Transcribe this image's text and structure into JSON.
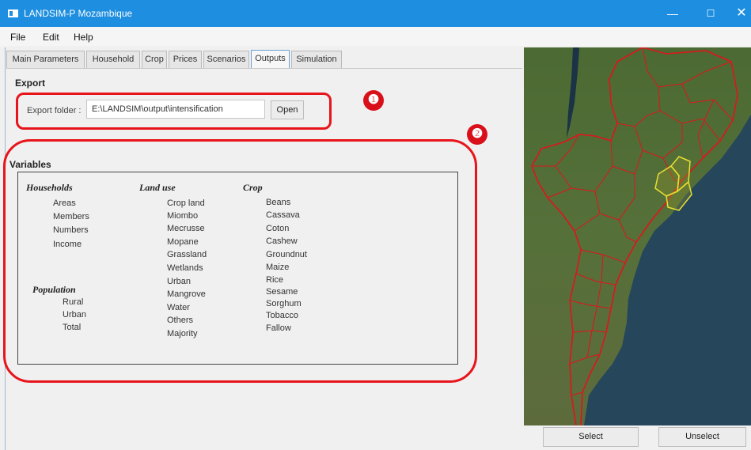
{
  "window": {
    "title": "LANDSIM-P Mozambique"
  },
  "menu": [
    "File",
    "Edit",
    "Help"
  ],
  "tabs": [
    "Main Parameters",
    "Household",
    "Crop",
    "Prices",
    "Scenarios",
    "Outputs",
    "Simulation"
  ],
  "active_tab": "Outputs",
  "export": {
    "heading": "Export",
    "folder_label": "Export folder :",
    "folder_value": "E:\\LANDSIM\\output\\intensification",
    "open_label": "Open"
  },
  "variables": {
    "heading": "Variables",
    "households": {
      "title": "Households",
      "items": [
        "Areas",
        "Members",
        "Numbers",
        "Income"
      ]
    },
    "population": {
      "title": "Population",
      "items": [
        "Rural",
        "Urban",
        "Total"
      ]
    },
    "land_use": {
      "title": "Land use",
      "items": [
        "Crop land",
        "Miombo",
        "Mecrusse",
        "Mopane",
        "Grassland",
        "Wetlands",
        "Urban",
        "Mangrove",
        "Water",
        "Others",
        "Majority"
      ]
    },
    "crop": {
      "title": "Crop",
      "items": [
        "Beans",
        "Cassava",
        "Coton",
        "Cashew",
        "Groundnut",
        "Maize",
        "Rice",
        "Sesame",
        "Sorghum",
        "Tobacco",
        "Fallow"
      ]
    }
  },
  "callouts": [
    "❶",
    "❷"
  ],
  "map_buttons": {
    "select": "Select",
    "unselect": "Unselect"
  },
  "colors": {
    "titlebar": "#1d8ee0",
    "highlight": "#e8141b",
    "district_border": "#e0141c",
    "selected_district": "#e8e030"
  }
}
